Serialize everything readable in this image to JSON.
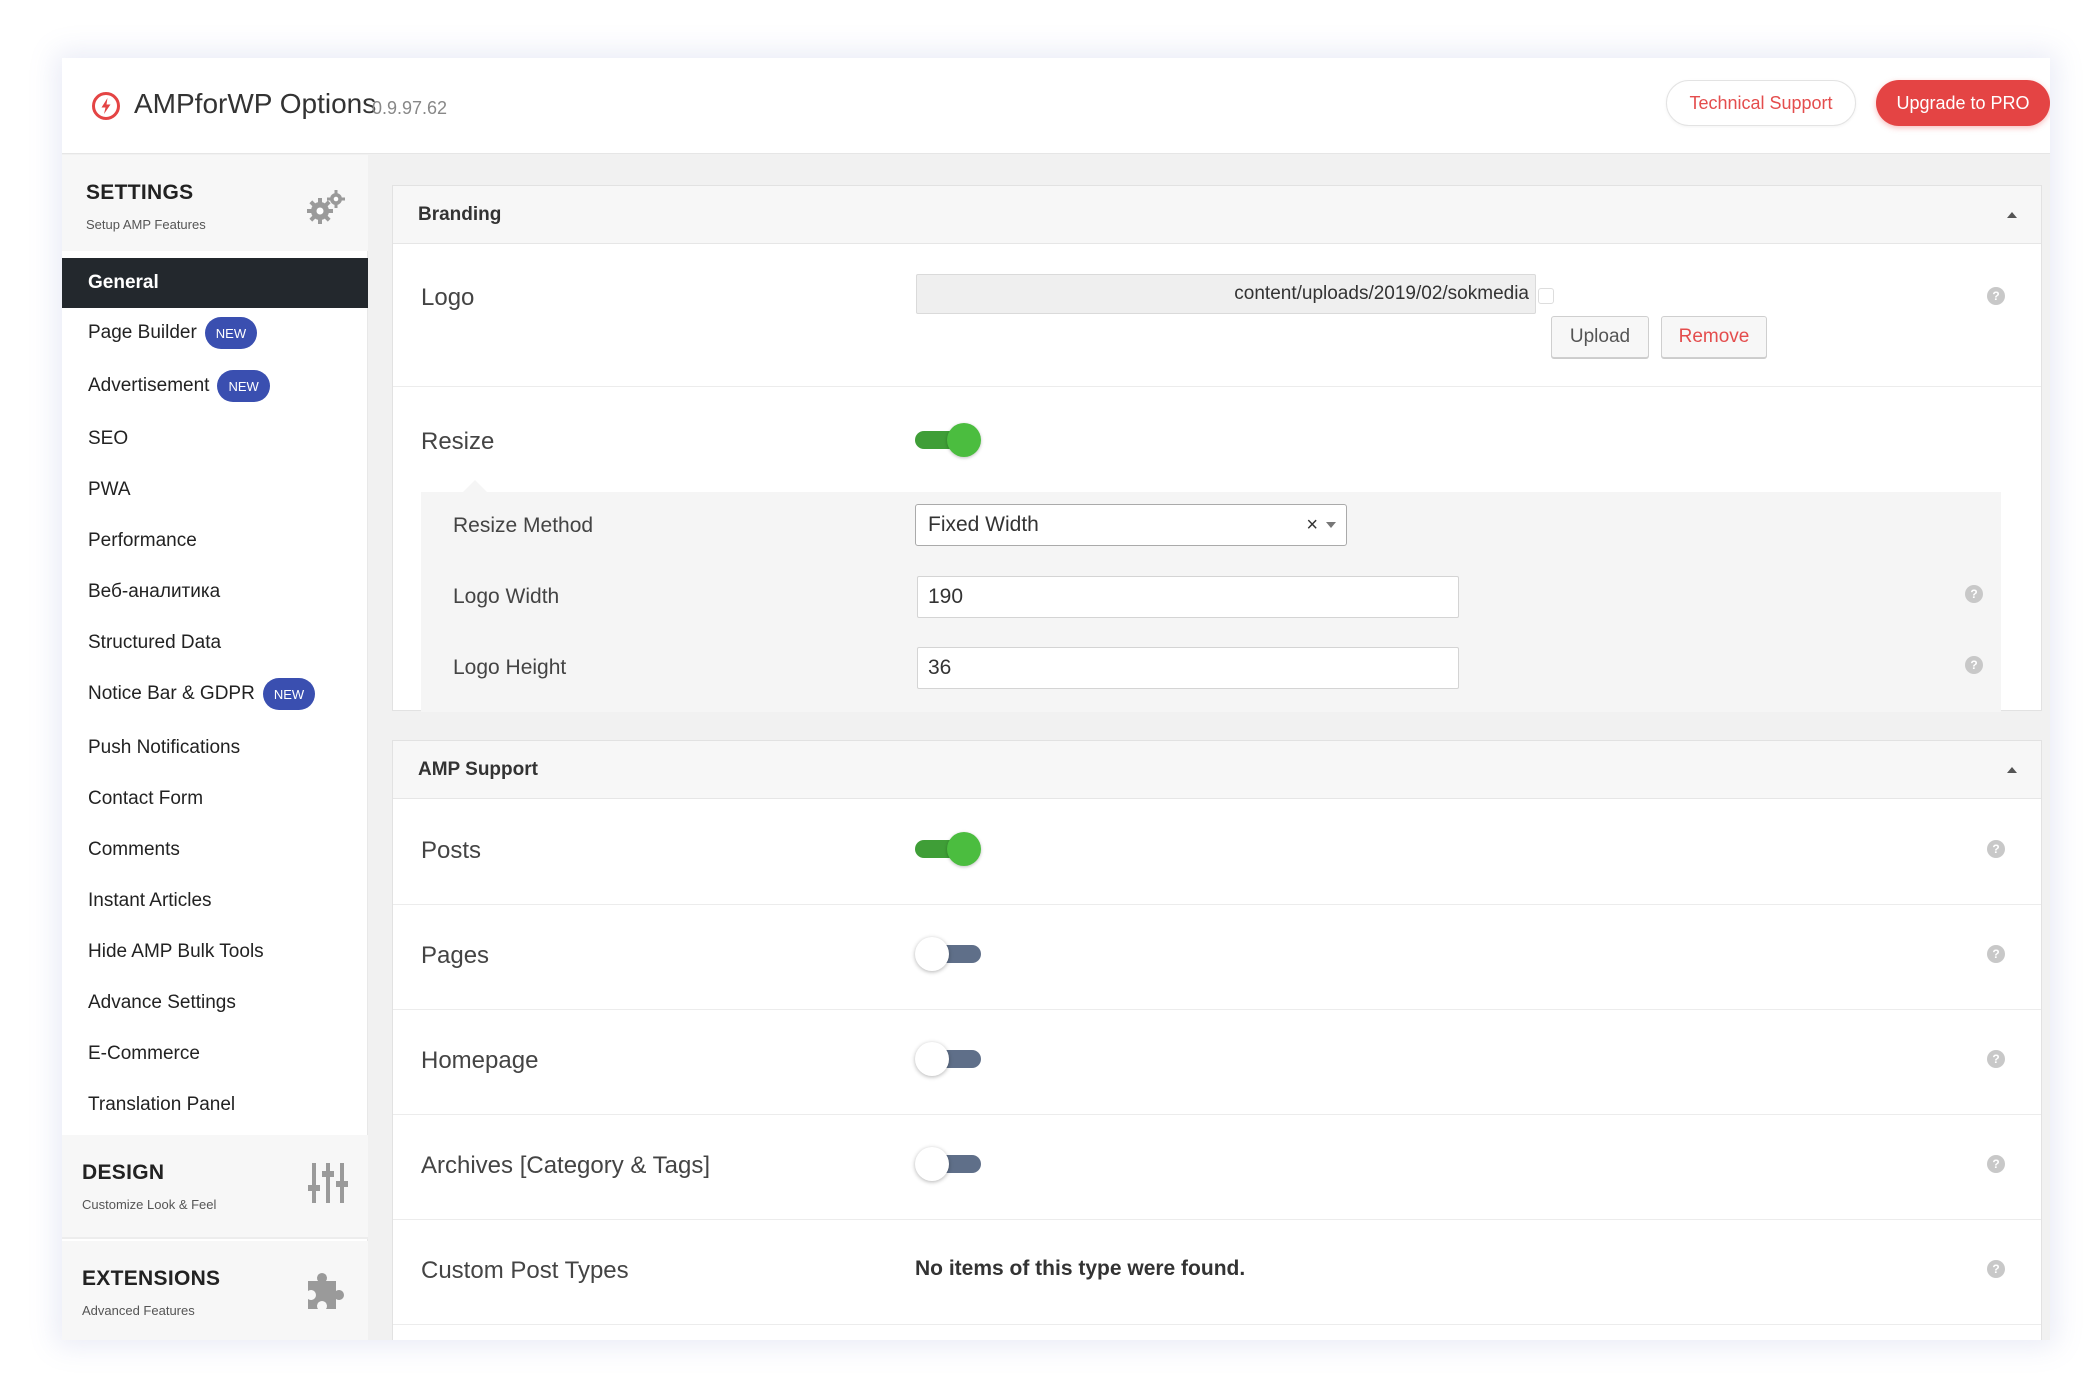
{
  "header": {
    "title": "AMPforWP Options",
    "version": "0.9.97.62",
    "support_label": "Technical Support",
    "upgrade_label": "Upgrade to PRO",
    "brand_color": "#e44444"
  },
  "sidebar": {
    "settings": {
      "title": "SETTINGS",
      "subtitle": "Setup AMP Features",
      "icon": "gears-icon"
    },
    "items": [
      {
        "label": "General",
        "active": true
      },
      {
        "label": "Page Builder",
        "badge": "NEW"
      },
      {
        "label": "Advertisement",
        "badge": "NEW"
      },
      {
        "label": "SEO"
      },
      {
        "label": "PWA"
      },
      {
        "label": "Performance"
      },
      {
        "label": "Веб-аналитика"
      },
      {
        "label": "Structured Data"
      },
      {
        "label": "Notice Bar & GDPR",
        "badge": "NEW"
      },
      {
        "label": "Push Notifications"
      },
      {
        "label": "Contact Form"
      },
      {
        "label": "Comments"
      },
      {
        "label": "Instant Articles"
      },
      {
        "label": "Hide AMP Bulk Tools"
      },
      {
        "label": "Advance Settings"
      },
      {
        "label": "E-Commerce"
      },
      {
        "label": "Translation Panel"
      }
    ],
    "design": {
      "title": "DESIGN",
      "subtitle": "Customize Look & Feel",
      "icon": "sliders-icon"
    },
    "extensions": {
      "title": "EXTENSIONS",
      "subtitle": "Advanced Features",
      "icon": "puzzle-icon"
    }
  },
  "branding": {
    "title": "Branding",
    "logo_label": "Logo",
    "logo_value": "content/uploads/2019/02/sokmedia",
    "upload_label": "Upload",
    "remove_label": "Remove",
    "resize_label": "Resize",
    "resize_on": true,
    "resize_method_label": "Resize Method",
    "resize_method_value": "Fixed Width",
    "resize_method_clear": "×",
    "logo_width_label": "Logo Width",
    "logo_width_value": "190",
    "logo_height_label": "Logo Height",
    "logo_height_value": "36"
  },
  "amp_support": {
    "title": "AMP Support",
    "posts_label": "Posts",
    "posts_on": true,
    "pages_label": "Pages",
    "pages_on": false,
    "homepage_label": "Homepage",
    "homepage_on": false,
    "archives_label": "Archives [Category & Tags]",
    "archives_on": false,
    "cpt_label": "Custom Post Types",
    "cpt_message": "No items of this type were found."
  },
  "help_glyph": "?"
}
